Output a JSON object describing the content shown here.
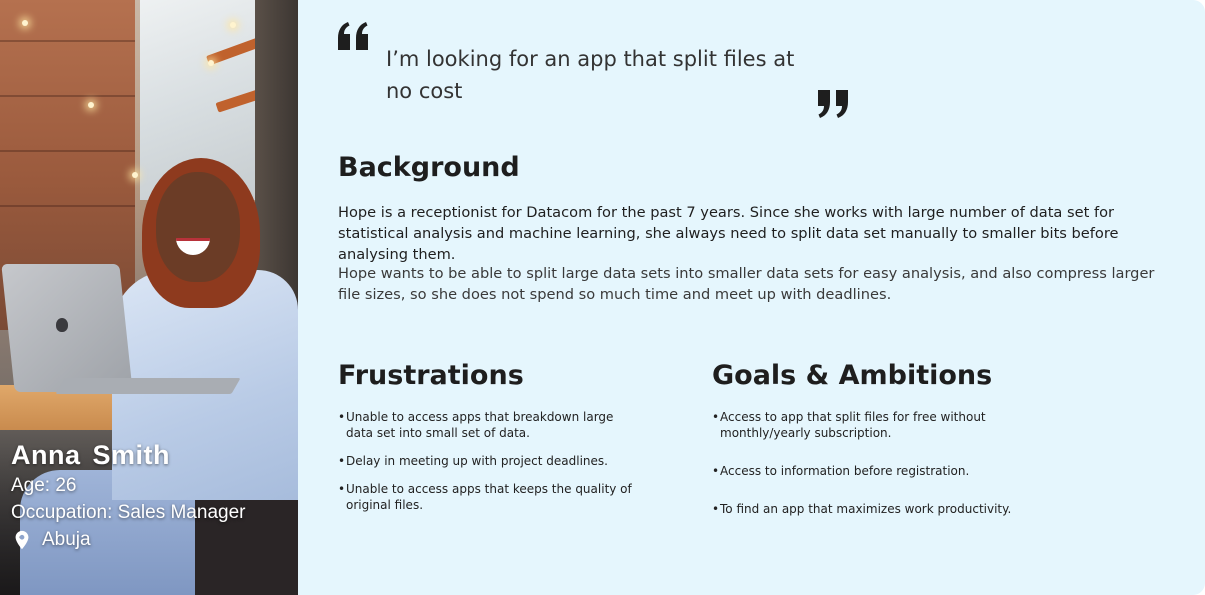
{
  "quote": "I’m looking for an app that split files at no cost",
  "background": {
    "title": "Background",
    "paragraphs": [
      "Hope is a receptionist for Datacom for the past 7 years. Since she works with large number of data set for statistical analysis and machine learning, she always need to split data set manually to smaller bits before analysing them.",
      "Hope wants to be able to split large data sets into smaller data sets for easy analysis, and also compress larger file sizes, so she does not spend so much time and meet up with deadlines."
    ]
  },
  "frustrations": {
    "title": "Frustrations",
    "items": [
      "Unable to access apps that breakdown large data set into small set of data.",
      "Delay in meeting up with project deadlines.",
      "Unable to access apps that keeps the quality of original files."
    ]
  },
  "goals": {
    "title": "Goals & Ambitions",
    "items": [
      "Access to app that split files for free without monthly/yearly subscription.",
      "Access to information before registration.",
      "To find an app that maximizes work productivity."
    ]
  },
  "profile": {
    "name": "Anna  Smith",
    "age": "Age: 26",
    "occupation": "Occupation: Sales Manager",
    "location": "Abuja"
  },
  "icons": {
    "quote_open": "quote-open-icon",
    "quote_close": "quote-close-icon",
    "location": "location-pin-icon"
  },
  "colors": {
    "card_background": "#e5f6fd",
    "heading": "#1e1e1e",
    "text": "#1f1f1f"
  }
}
